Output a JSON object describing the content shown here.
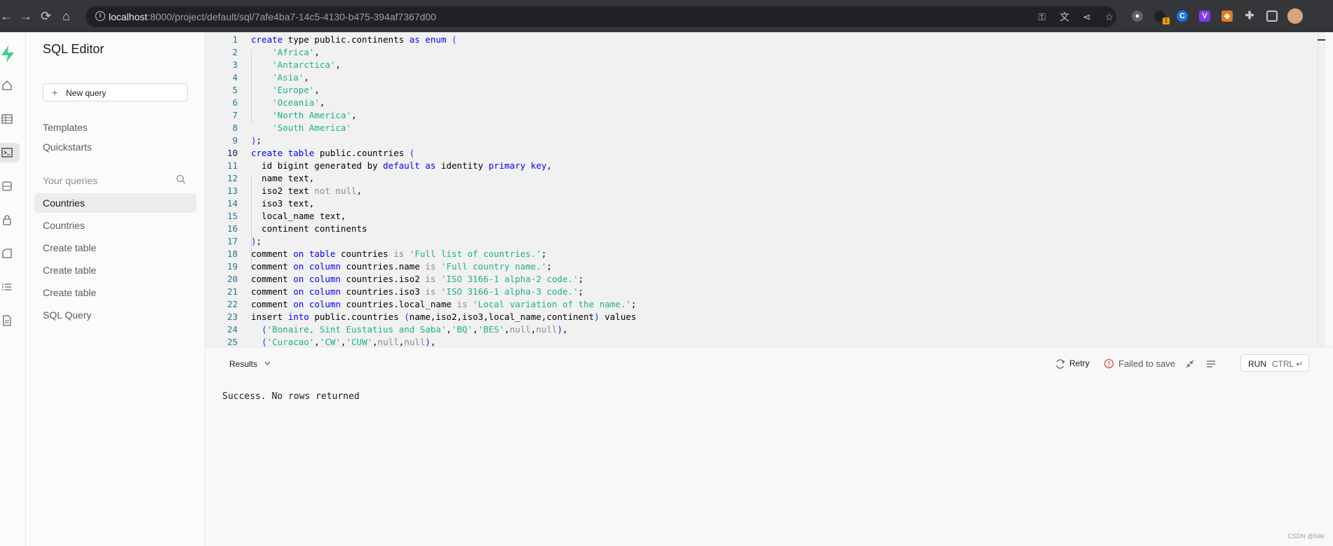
{
  "browser": {
    "url_host": "localhost",
    "url_path": ":8000/project/default/sql/7afe4ba7-14c5-4130-b475-394af7367d00",
    "extension_badge": "1"
  },
  "rail": {
    "items": [
      "home",
      "table-editor",
      "sql-editor",
      "database",
      "auth",
      "storage",
      "logs",
      "docs"
    ],
    "active": "sql-editor"
  },
  "sidebar": {
    "title": "SQL Editor",
    "new_query_label": "New query",
    "links": [
      "Templates",
      "Quickstarts"
    ],
    "queries_section": "Your queries",
    "queries": [
      "Countries",
      "Countries",
      "Create table",
      "Create table",
      "Create table",
      "SQL Query"
    ],
    "active_query_index": 0
  },
  "editor": {
    "current_line": 10,
    "line_numbers": [
      "1",
      "2",
      "3",
      "4",
      "5",
      "6",
      "7",
      "8",
      "9",
      "10",
      "11",
      "12",
      "13",
      "14",
      "15",
      "16",
      "17",
      "18",
      "19",
      "20",
      "21",
      "22",
      "23",
      "24",
      "25"
    ],
    "lines": [
      [
        [
          "create",
          "kw"
        ],
        [
          " type public.continents ",
          ""
        ],
        [
          "as",
          "kw"
        ],
        [
          " ",
          ""
        ],
        [
          "enum",
          "kw"
        ],
        [
          " ",
          ""
        ],
        [
          "(",
          "pun"
        ]
      ],
      [
        [
          "    ",
          ""
        ],
        [
          "'Africa'",
          "str"
        ],
        [
          ",",
          ""
        ]
      ],
      [
        [
          "    ",
          ""
        ],
        [
          "'Antarctica'",
          "str"
        ],
        [
          ",",
          ""
        ]
      ],
      [
        [
          "    ",
          ""
        ],
        [
          "'Asia'",
          "str"
        ],
        [
          ",",
          ""
        ]
      ],
      [
        [
          "    ",
          ""
        ],
        [
          "'Europe'",
          "str"
        ],
        [
          ",",
          ""
        ]
      ],
      [
        [
          "    ",
          ""
        ],
        [
          "'Oceania'",
          "str"
        ],
        [
          ",",
          ""
        ]
      ],
      [
        [
          "    ",
          ""
        ],
        [
          "'North America'",
          "str"
        ],
        [
          ",",
          ""
        ]
      ],
      [
        [
          "    ",
          ""
        ],
        [
          "'South America'",
          "str"
        ]
      ],
      [
        [
          ")",
          "pun"
        ],
        [
          ";",
          ""
        ]
      ],
      [
        [
          "create",
          "kw"
        ],
        [
          " ",
          ""
        ],
        [
          "table",
          "kw"
        ],
        [
          " public.countries ",
          ""
        ],
        [
          "(",
          "pun"
        ]
      ],
      [
        [
          "  id bigint generated by ",
          ""
        ],
        [
          "default",
          "kw"
        ],
        [
          " ",
          ""
        ],
        [
          "as",
          "kw"
        ],
        [
          " identity ",
          ""
        ],
        [
          "primary",
          "kw"
        ],
        [
          " ",
          ""
        ],
        [
          "key",
          "kw"
        ],
        [
          ",",
          ""
        ]
      ],
      [
        [
          "  name text,",
          ""
        ]
      ],
      [
        [
          "  iso2 text ",
          ""
        ],
        [
          "not null",
          "op"
        ],
        [
          ",",
          ""
        ]
      ],
      [
        [
          "  iso3 text,",
          ""
        ]
      ],
      [
        [
          "  local_name text,",
          ""
        ]
      ],
      [
        [
          "  continent continents",
          ""
        ]
      ],
      [
        [
          ")",
          "pun"
        ],
        [
          ";",
          ""
        ]
      ],
      [
        [
          "comment ",
          ""
        ],
        [
          "on",
          "kw"
        ],
        [
          " ",
          ""
        ],
        [
          "table",
          "kw"
        ],
        [
          " countries ",
          ""
        ],
        [
          "is",
          "op"
        ],
        [
          " ",
          ""
        ],
        [
          "'Full list of countries.'",
          "str"
        ],
        [
          ";",
          ""
        ]
      ],
      [
        [
          "comment ",
          ""
        ],
        [
          "on",
          "kw"
        ],
        [
          " ",
          ""
        ],
        [
          "column",
          "kw"
        ],
        [
          " countries.name ",
          ""
        ],
        [
          "is",
          "op"
        ],
        [
          " ",
          ""
        ],
        [
          "'Full country name.'",
          "str"
        ],
        [
          ";",
          ""
        ]
      ],
      [
        [
          "comment ",
          ""
        ],
        [
          "on",
          "kw"
        ],
        [
          " ",
          ""
        ],
        [
          "column",
          "kw"
        ],
        [
          " countries.iso2 ",
          ""
        ],
        [
          "is",
          "op"
        ],
        [
          " ",
          ""
        ],
        [
          "'ISO 3166-1 alpha-2 code.'",
          "str"
        ],
        [
          ";",
          ""
        ]
      ],
      [
        [
          "comment ",
          ""
        ],
        [
          "on",
          "kw"
        ],
        [
          " ",
          ""
        ],
        [
          "column",
          "kw"
        ],
        [
          " countries.iso3 ",
          ""
        ],
        [
          "is",
          "op"
        ],
        [
          " ",
          ""
        ],
        [
          "'ISO 3166-1 alpha-3 code.'",
          "str"
        ],
        [
          ";",
          ""
        ]
      ],
      [
        [
          "comment ",
          ""
        ],
        [
          "on",
          "kw"
        ],
        [
          " ",
          ""
        ],
        [
          "column",
          "kw"
        ],
        [
          " countries.local_name ",
          ""
        ],
        [
          "is",
          "op"
        ],
        [
          " ",
          ""
        ],
        [
          "'Local variation of the name.'",
          "str"
        ],
        [
          ";",
          ""
        ]
      ],
      [
        [
          "insert ",
          ""
        ],
        [
          "into",
          "kw"
        ],
        [
          " public.countries ",
          ""
        ],
        [
          "(",
          "pun"
        ],
        [
          "name,iso2,iso3,local_name,continent",
          ""
        ],
        [
          ")",
          "pun"
        ],
        [
          " values",
          ""
        ]
      ],
      [
        [
          "  ",
          ""
        ],
        [
          "(",
          "pun"
        ],
        [
          "'Bonaire, Sint Eustatius and Saba'",
          "str"
        ],
        [
          ",",
          ""
        ],
        [
          "'BQ'",
          "str"
        ],
        [
          ",",
          ""
        ],
        [
          "'BES'",
          "str"
        ],
        [
          ",",
          ""
        ],
        [
          "null",
          "op"
        ],
        [
          ",",
          ""
        ],
        [
          "null",
          "op"
        ],
        [
          ")",
          "pun"
        ],
        [
          ",",
          ""
        ]
      ],
      [
        [
          "  ",
          ""
        ],
        [
          "(",
          "pun"
        ],
        [
          "'Curacao'",
          "str"
        ],
        [
          ",",
          ""
        ],
        [
          "'CW'",
          "str"
        ],
        [
          ",",
          ""
        ],
        [
          "'CUW'",
          "str"
        ],
        [
          ",",
          ""
        ],
        [
          "null",
          "op"
        ],
        [
          ",",
          ""
        ],
        [
          "null",
          "op"
        ],
        [
          ")",
          "pun"
        ],
        [
          ",",
          ""
        ]
      ]
    ]
  },
  "results": {
    "tab_label": "Results",
    "retry_label": "Retry",
    "status_label": "Failed to save",
    "run_label": "RUN",
    "run_shortcut": "CTRL ↵",
    "message": "Success. No rows returned"
  },
  "watermark": "CSDN @Nile"
}
